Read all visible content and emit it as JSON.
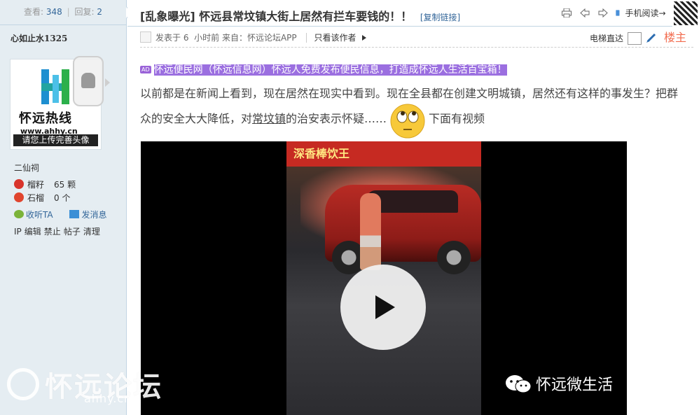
{
  "sidebar": {
    "views_label": "查看:",
    "views": "348",
    "replies_label": "回复:",
    "replies": "2",
    "username": "心如止水1325",
    "avatar": {
      "brand": "怀远热线",
      "url": "www.ahhy.cn",
      "tip": "请您上传完善头像"
    },
    "group": "二仙祠",
    "credits": [
      {
        "name": "榴籽",
        "value": "65 颗",
        "color": "#d8342c"
      },
      {
        "name": "石榴",
        "value": "0 个",
        "color": "#e0452e"
      }
    ],
    "listen_label": "收听TA",
    "message_label": "发消息",
    "admin": [
      "IP",
      "编辑",
      "禁止",
      "帖子",
      "清理"
    ]
  },
  "watermark": {
    "text": "怀远论坛",
    "url": "ahhy.cn"
  },
  "thread": {
    "category": "[乱象曝光]",
    "title": "怀远县常坟镇大街上居然有拦车要钱的！！",
    "copy_link": "[复制链接]",
    "tools": {
      "mobile_read": "手机阅读→"
    }
  },
  "post": {
    "posted_prefix": "发表于",
    "posted_num": "6",
    "posted_unit": "小时前",
    "source": "来自：怀远论坛APP",
    "author_only": "只看该作者",
    "elevator": "电梯直达",
    "floor": "楼主",
    "ad_tag": "AD",
    "ad_text": "怀远便民网（怀远信息网）怀远人免费发布便民信息，打造成怀远人生活百宝箱！",
    "body_1": "以前都是在新闻上看到，现在居然在现实中看到。现在全县都在创建文明城镇，居然还有这样的事发生？把群众的安全大大降低，对",
    "body_link": "常坟镇",
    "body_2": "的治安表示怀疑……",
    "body_3": "下面有视频"
  },
  "video": {
    "shop_sign": "深香棒饮王",
    "watermark": "怀远微生活"
  },
  "colors": {
    "sidebar_bg": "#e5edf2",
    "link": "#336699",
    "ad_highlight": "#9b6fe0",
    "floor": "#f26c4f"
  }
}
